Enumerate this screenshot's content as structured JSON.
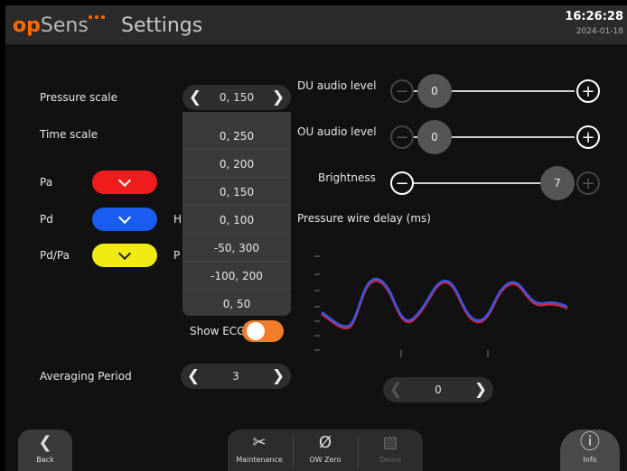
{
  "header": {
    "logo_op": "op",
    "logo_sens": "Sens",
    "title": "Settings",
    "time": "16:26:28",
    "date": "2024-01-18"
  },
  "left": {
    "pressure_scale_label": "Pressure scale",
    "pressure_scale_value": "0, 150",
    "time_scale_label": "Time scale",
    "pa_label": "Pa",
    "pd_label": "Pd",
    "pdpa_label": "Pd/Pa",
    "pd_hidden_fragment": "H",
    "pdpa_hidden_fragment": "P",
    "averaging_label": "Averaging Period",
    "averaging_value": "3",
    "show_ecg_label": "Show ECG",
    "show_ecg_on": true
  },
  "colors": {
    "pa": "#ee1c1c",
    "pd": "#1a5cf0",
    "pdpa": "#f2ea14",
    "accent": "#f07d2a",
    "logo": "#ff6a00"
  },
  "dropdown": {
    "options": [
      "0, 250",
      "0, 200",
      "0, 150",
      "0, 100",
      "-50, 300",
      "-100, 200",
      "0, 50"
    ]
  },
  "right": {
    "du_label": "DU audio level",
    "du_value": "0",
    "ou_label": "OU audio level",
    "ou_value": "0",
    "brightness_label": "Brightness",
    "brightness_value": "7",
    "wire_delay_label": "Pressure wire delay (ms)",
    "wire_delay_value": "0"
  },
  "icons": {
    "left_arrow": "❮",
    "right_arrow": "❯",
    "minus": "−",
    "plus": "+",
    "back": "❮",
    "maintenance": "✂",
    "zero": "Ø",
    "demo": "▧",
    "info": "ⓘ"
  },
  "footer": {
    "back": "Back",
    "maintenance": "Maintenance",
    "ow_zero": "OW Zero",
    "demo": "Demo",
    "info": "Info"
  }
}
